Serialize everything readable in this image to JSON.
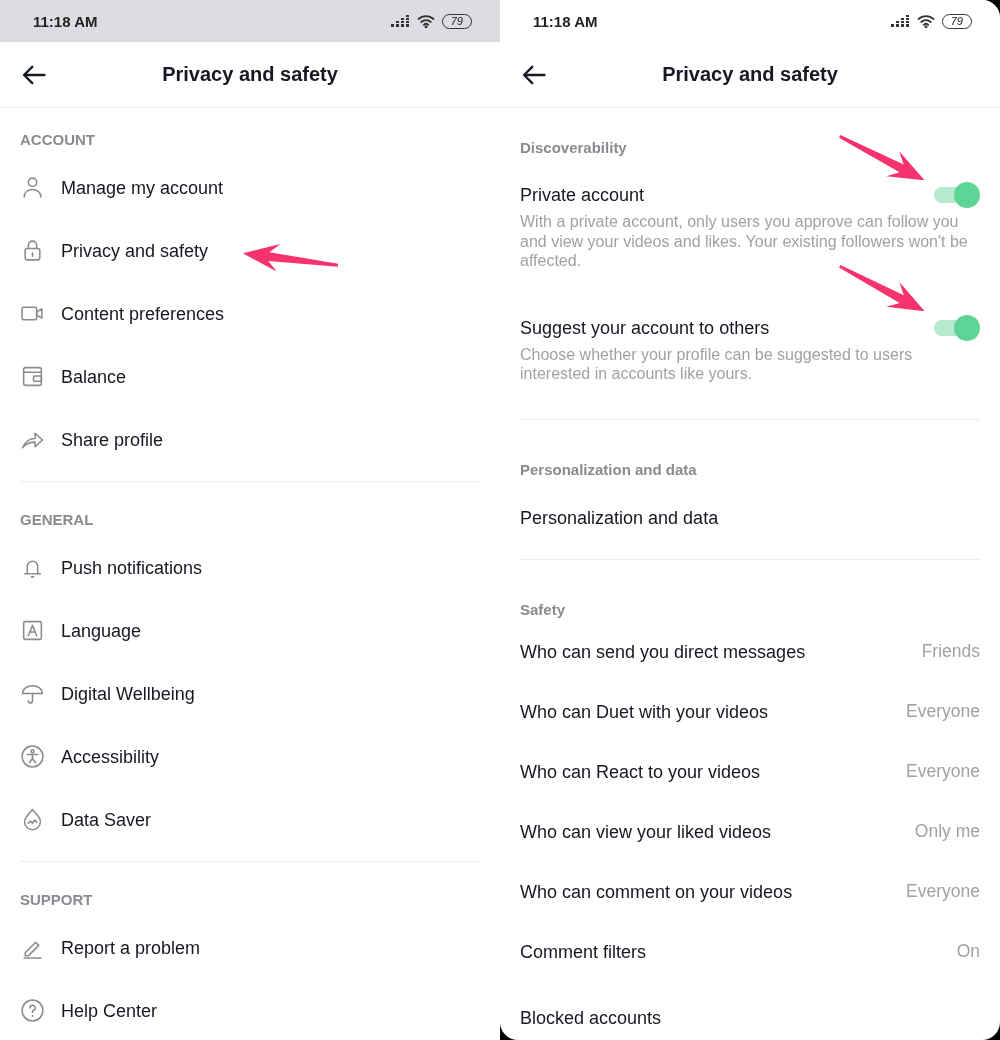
{
  "left_screen": {
    "status_bar": {
      "time": "11:18 AM",
      "battery": "79"
    },
    "header": {
      "title": "Privacy and safety"
    },
    "sections": [
      {
        "title": "ACCOUNT",
        "items": [
          {
            "label": "Manage my account"
          },
          {
            "label": "Privacy and safety"
          },
          {
            "label": "Content preferences"
          },
          {
            "label": "Balance"
          },
          {
            "label": "Share profile"
          }
        ]
      },
      {
        "title": "GENERAL",
        "items": [
          {
            "label": "Push notifications"
          },
          {
            "label": "Language"
          },
          {
            "label": "Digital Wellbeing"
          },
          {
            "label": "Accessibility"
          },
          {
            "label": "Data Saver"
          }
        ]
      },
      {
        "title": "SUPPORT",
        "items": [
          {
            "label": "Report a problem"
          },
          {
            "label": "Help Center"
          }
        ]
      }
    ]
  },
  "right_screen": {
    "status_bar": {
      "time": "11:18 AM",
      "battery": "79"
    },
    "header": {
      "title": "Privacy and safety"
    },
    "sections": [
      {
        "title": "Discoverability",
        "items": [
          {
            "kind": "toggle",
            "label": "Private account",
            "description": "With a private account, only users you approve can follow you and view your videos and likes. Your existing followers won't be affected.",
            "on": true
          },
          {
            "kind": "toggle",
            "label": "Suggest your account to others",
            "description": "Choose whether your profile can be suggested to users interested in accounts like yours.",
            "on": true
          }
        ]
      },
      {
        "title": "Personalization and data",
        "items": [
          {
            "kind": "link",
            "label": "Personalization and data"
          }
        ]
      },
      {
        "title": "Safety",
        "items": [
          {
            "kind": "value",
            "label": "Who can send you direct messages",
            "value": "Friends"
          },
          {
            "kind": "value",
            "label": "Who can Duet with your videos",
            "value": "Everyone"
          },
          {
            "kind": "value",
            "label": "Who can React to your videos",
            "value": "Everyone"
          },
          {
            "kind": "value",
            "label": "Who can view your liked videos",
            "value": "Only me"
          },
          {
            "kind": "value",
            "label": "Who can comment on your videos",
            "value": "Everyone"
          },
          {
            "kind": "value",
            "label": "Comment filters",
            "value": "On"
          },
          {
            "kind": "link",
            "label": "Blocked accounts"
          }
        ]
      }
    ]
  }
}
